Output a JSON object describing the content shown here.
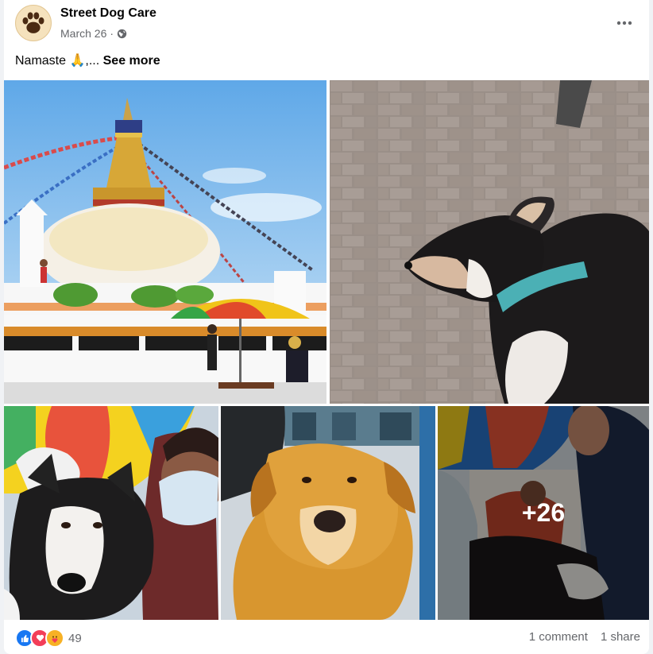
{
  "post": {
    "page_name": "Street Dog Care",
    "date": "March 26",
    "separator": "·",
    "privacy_icon": "globe-icon",
    "more_icon": "more-options-icon",
    "caption": "Namaste 🙏,...",
    "see_more": "See more"
  },
  "photos": {
    "more_count": "+26"
  },
  "footer": {
    "reactions": [
      "like-icon",
      "love-icon",
      "care-icon"
    ],
    "reaction_count": "49",
    "comments": "1 comment",
    "shares": "1 share"
  },
  "colors": {
    "like": "#1877f2",
    "love": "#f33e58",
    "care": "#f7b125",
    "secondary_text": "#65676b"
  }
}
